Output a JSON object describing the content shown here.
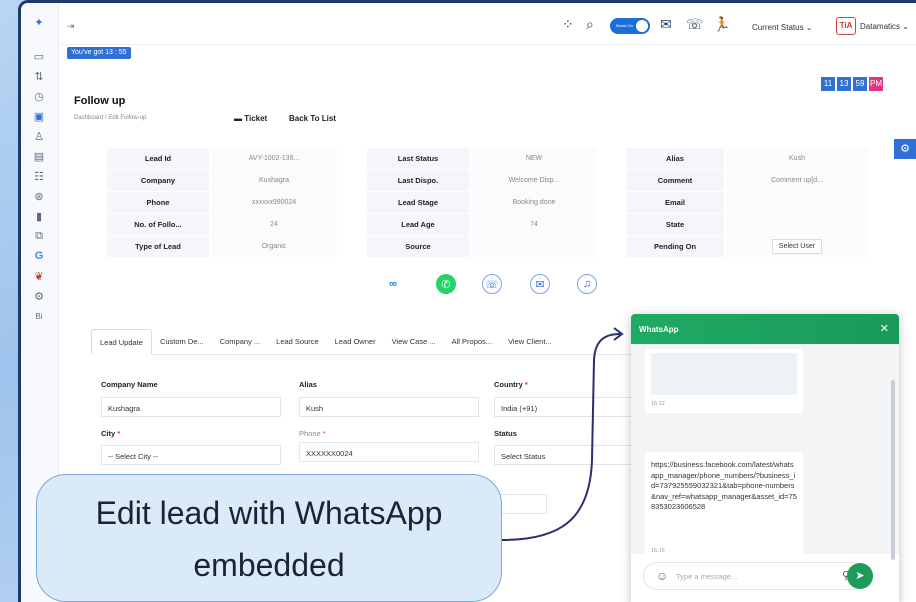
{
  "timer_badge": "You've got 13 : 55",
  "clock": {
    "h": "11",
    "m": "13",
    "s": "59",
    "ampm": "PM"
  },
  "topbar": {
    "toggle_label": "Break On",
    "current_status": "Current Status ⌄",
    "brand_logo": "TiA",
    "brand_name": "Datamatics ⌄",
    "icons": [
      "apps-icon",
      "search-icon",
      "mail-icon",
      "phone-icon",
      "agent-icon"
    ]
  },
  "page": {
    "title": "Follow up",
    "breadcrumb": "Dashboard / Edit Follow-up",
    "ticket_label": "Ticket",
    "back_label": "Back To List"
  },
  "info": {
    "col1": [
      {
        "label": "Lead Id",
        "value": "AVY-1002-136..."
      },
      {
        "label": "Company",
        "value": "Kushagra"
      },
      {
        "label": "Phone",
        "value": "xxxxxx990024"
      },
      {
        "label": "No. of Follo...",
        "value": "24"
      },
      {
        "label": "Type of Lead",
        "value": "Organic"
      }
    ],
    "col2": [
      {
        "label": "Last Status",
        "value": "NEW"
      },
      {
        "label": "Last Dispo.",
        "value": "Welcome Disp..."
      },
      {
        "label": "Lead Stage",
        "value": "Booking done"
      },
      {
        "label": "Lead Age",
        "value": "74"
      },
      {
        "label": "Source",
        "value": ""
      }
    ],
    "col3": [
      {
        "label": "Alias",
        "value": "Kush"
      },
      {
        "label": "Comment",
        "value": "Comment up[d..."
      },
      {
        "label": "Email",
        "value": ""
      },
      {
        "label": "State",
        "value": ""
      },
      {
        "label": "Pending On",
        "value": "Select User"
      }
    ]
  },
  "tabs": [
    "Lead Update",
    "Custom De...",
    "Company ...",
    "Lead Source",
    "Lead Owner",
    "View Case ...",
    "All Propos...",
    "View Client..."
  ],
  "form": {
    "company_label": "Company Name",
    "company_value": "Kushagra",
    "alias_label": "Alias",
    "alias_value": "Kush",
    "country_label": "Country",
    "country_value": "India (+91)",
    "city_label": "City",
    "city_value": "-- Select City --",
    "phone_label": "Phone",
    "phone_value": "XXXXXX0024",
    "status_label": "Status",
    "status_value": "Select Status",
    "required_mark": "*"
  },
  "whatsapp": {
    "title": "WhatsApp",
    "close": "✕",
    "img_time": "16:12",
    "message": "https://business.facebook.com/latest/whatsapp_manager/phone_numbers/?business_id=737925559032321&tab=phone-numbers&nav_ref=whatsapp_manager&asset_id=758353023606528",
    "msg_time": "16:16",
    "input_placeholder": "Type a message..."
  },
  "callout": {
    "line1": "Edit lead with WhatsApp",
    "line2": "embedded"
  }
}
